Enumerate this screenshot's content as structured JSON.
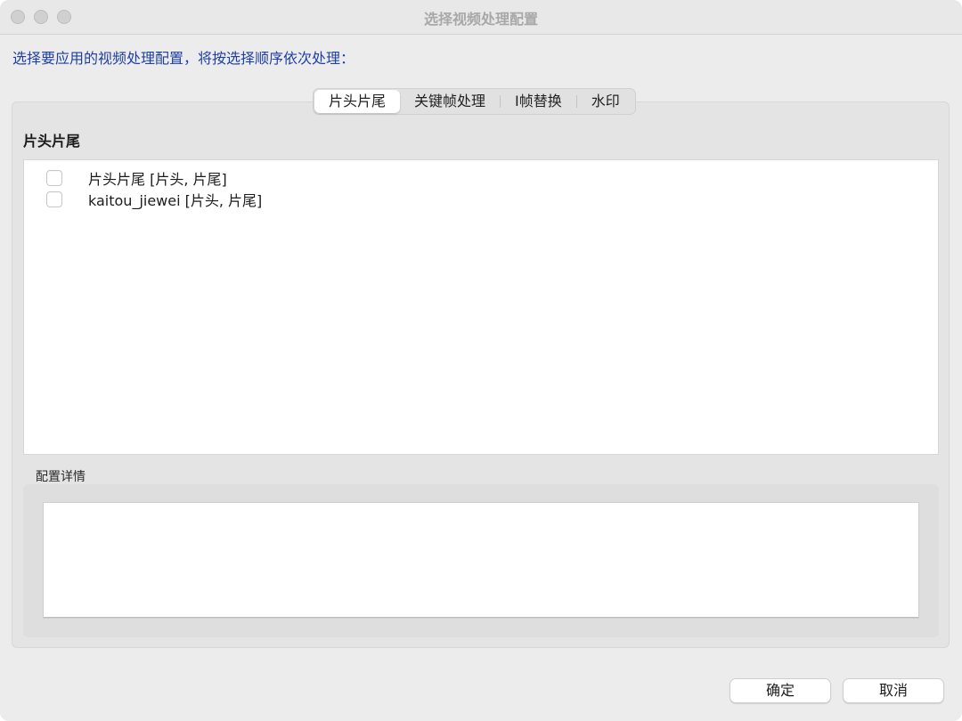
{
  "window": {
    "title": "选择视频处理配置"
  },
  "instruction": "选择要应用的视频处理配置，将按选择顺序依次处理：",
  "tabs": [
    {
      "label": "片头片尾",
      "active": true
    },
    {
      "label": "关键帧处理",
      "active": false
    },
    {
      "label": "I帧替换",
      "active": false
    },
    {
      "label": "水印",
      "active": false
    }
  ],
  "section": {
    "title": "片头片尾",
    "items": [
      {
        "label": "片头片尾 [片头, 片尾]",
        "checked": false
      },
      {
        "label": "kaitou_jiewei [片头, 片尾]",
        "checked": false
      }
    ]
  },
  "details": {
    "label": "配置详情",
    "text": ""
  },
  "buttons": {
    "ok": "确定",
    "cancel": "取消"
  },
  "colors": {
    "accent_text": "#1f3fa3",
    "window_bg": "#ececec",
    "traffic_inactive": "#d0d0d0"
  }
}
